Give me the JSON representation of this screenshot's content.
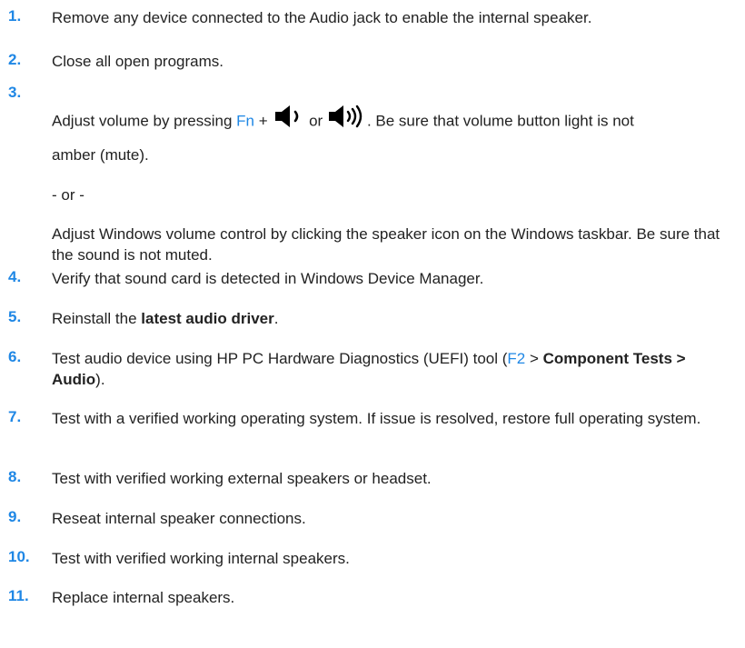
{
  "steps": [
    {
      "num": "1.",
      "text": "Remove any device connected to the Audio jack to enable the internal speaker."
    },
    {
      "num": "2.",
      "text": "Close all open programs."
    },
    {
      "num": "3.",
      "part_adjust": "Adjust volume by pressing ",
      "key_fn": "Fn",
      "part_plus": " + ",
      "part_or": " or ",
      "part_end": ". Be sure that volume button light is not",
      "line2": "amber (mute).",
      "separator": "- or -",
      "alt_text": "Adjust Windows volume control by clicking the speaker icon on the Windows taskbar. Be sure that the sound is not muted.",
      "icon_low": "volume-down-icon",
      "icon_high": "volume-up-icon"
    },
    {
      "num": "4.",
      "text": "Verify that sound card is detected in Windows Device Manager."
    },
    {
      "num": "5.",
      "pre": "Reinstall the ",
      "bold": "latest audio driver",
      "post": "."
    },
    {
      "num": "6.",
      "pre": "Test audio device using HP PC Hardware Diagnostics (UEFI) tool (",
      "key": "F2",
      "mid": " > ",
      "bold": "Component Tests > Audio",
      "post": ")."
    },
    {
      "num": "7.",
      "text": "Test with a verified working operating system. If issue is resolved, restore full operating system."
    },
    {
      "num": "8.",
      "text": "Test with verified working external speakers or headset."
    },
    {
      "num": "9.",
      "text": "Reseat internal speaker connections."
    },
    {
      "num": "10.",
      "text": "Test with verified working internal speakers."
    },
    {
      "num": "11.",
      "text": "Replace internal speakers."
    }
  ],
  "colors": {
    "accent": "#1f87e5",
    "text": "#222222"
  }
}
